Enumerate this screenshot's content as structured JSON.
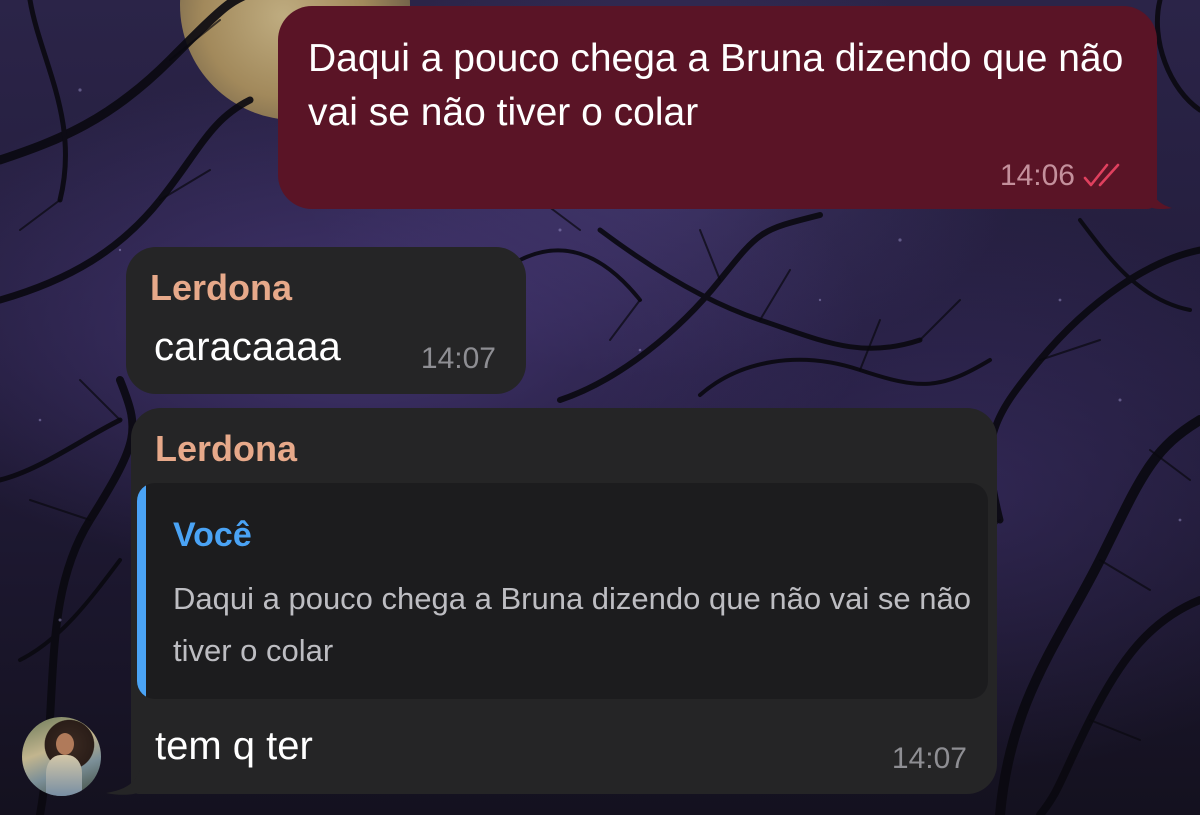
{
  "messages": {
    "outgoing": {
      "text": "Daqui a pouco chega a Bruna dizendo que não vai se não tiver o colar",
      "time": "14:06",
      "status_icon": "double-check-icon"
    },
    "incoming_1": {
      "sender": "Lerdona",
      "text": "caracaaaa",
      "time": "14:07"
    },
    "incoming_2": {
      "sender": "Lerdona",
      "reply": {
        "author": "Você",
        "text": "Daqui a pouco chega a Bruna dizendo que não vai se não tiver o colar"
      },
      "text": "tem q ter",
      "time": "14:07"
    }
  },
  "colors": {
    "outgoing_bubble": "#5a1426",
    "incoming_bubble": "#252526",
    "sender_name": "#e7a98a",
    "reply_accent": "#4aa3f5",
    "read_check": "#e0405e"
  }
}
